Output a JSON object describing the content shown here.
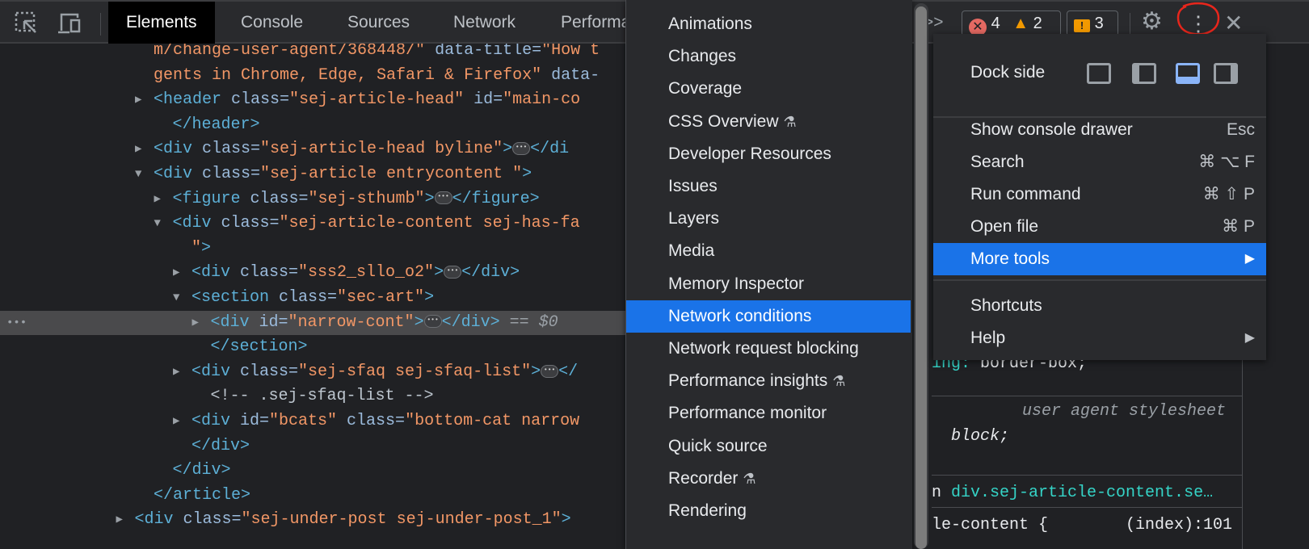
{
  "toolbar": {
    "tabs": [
      "Elements",
      "Console",
      "Sources",
      "Network",
      "Performance"
    ],
    "more_tabs_label": ">>",
    "errors": "4",
    "warnings": "2",
    "issues": "3"
  },
  "dom": [
    {
      "indent": 0,
      "arrow": "",
      "segs": [
        [
          "val",
          "m/change-user-agent/368448/\""
        ],
        [
          "attr",
          " data-title="
        ],
        [
          "val",
          "\"How t"
        ]
      ]
    },
    {
      "indent": 0,
      "arrow": "",
      "segs": [
        [
          "val",
          "gents in Chrome, Edge, Safari & Firefox\""
        ],
        [
          "attr",
          " data-"
        ]
      ]
    },
    {
      "indent": 0,
      "arrow": "right",
      "segs": [
        [
          "tag",
          "<header"
        ],
        [
          "attr",
          " class="
        ],
        [
          "val",
          "\"sej-article-head\""
        ],
        [
          "attr",
          " id="
        ],
        [
          "val",
          "\"main-co"
        ]
      ]
    },
    {
      "indent": 1,
      "arrow": "",
      "segs": [
        [
          "tag",
          "</header>"
        ]
      ]
    },
    {
      "indent": 0,
      "arrow": "right",
      "segs": [
        [
          "tag",
          "<div"
        ],
        [
          "attr",
          " class="
        ],
        [
          "val",
          "\"sej-article-head byline\""
        ],
        [
          "tag",
          ">"
        ],
        [
          "dots",
          ""
        ],
        [
          "tag",
          "</di"
        ]
      ]
    },
    {
      "indent": 0,
      "arrow": "down",
      "segs": [
        [
          "tag",
          "<div"
        ],
        [
          "attr",
          " class="
        ],
        [
          "val",
          "\"sej-article entrycontent \""
        ],
        [
          "tag",
          ">"
        ]
      ]
    },
    {
      "indent": 1,
      "arrow": "right",
      "segs": [
        [
          "tag",
          "<figure"
        ],
        [
          "attr",
          " class="
        ],
        [
          "val",
          "\"sej-sthumb\""
        ],
        [
          "tag",
          ">"
        ],
        [
          "dots",
          ""
        ],
        [
          "tag",
          "</figure>"
        ]
      ]
    },
    {
      "indent": 1,
      "arrow": "down",
      "segs": [
        [
          "tag",
          "<div"
        ],
        [
          "attr",
          " class="
        ],
        [
          "val",
          "\"sej-article-content sej-has-fa"
        ]
      ]
    },
    {
      "indent": 2,
      "arrow": "",
      "segs": [
        [
          "val",
          "\""
        ],
        [
          "tag",
          ">"
        ]
      ]
    },
    {
      "indent": 2,
      "arrow": "right",
      "segs": [
        [
          "tag",
          "<div"
        ],
        [
          "attr",
          " class="
        ],
        [
          "val",
          "\"sss2_sllo_o2\""
        ],
        [
          "tag",
          ">"
        ],
        [
          "dots",
          ""
        ],
        [
          "tag",
          "</div>"
        ]
      ]
    },
    {
      "indent": 2,
      "arrow": "down",
      "segs": [
        [
          "tag",
          "<section"
        ],
        [
          "attr",
          " class="
        ],
        [
          "val",
          "\"sec-art\""
        ],
        [
          "tag",
          ">"
        ]
      ]
    },
    {
      "indent": 3,
      "arrow": "right",
      "selected": true,
      "segs": [
        [
          "tag",
          "<div"
        ],
        [
          "attr",
          " id="
        ],
        [
          "val",
          "\"narrow-cont\""
        ],
        [
          "tag",
          ">"
        ],
        [
          "dots",
          ""
        ],
        [
          "tag",
          "</div>"
        ],
        [
          "eq",
          " == $0"
        ]
      ]
    },
    {
      "indent": 3,
      "arrow": "",
      "segs": [
        [
          "tag",
          "</section>"
        ]
      ]
    },
    {
      "indent": 2,
      "arrow": "right",
      "segs": [
        [
          "tag",
          "<div"
        ],
        [
          "attr",
          " class="
        ],
        [
          "val",
          "\"sej-sfaq sej-sfaq-list\""
        ],
        [
          "tag",
          ">"
        ],
        [
          "dots",
          ""
        ],
        [
          "tag",
          "</"
        ]
      ]
    },
    {
      "indent": 3,
      "arrow": "",
      "segs": [
        [
          "comment",
          "<!-- .sej-sfaq-list -->"
        ]
      ]
    },
    {
      "indent": 2,
      "arrow": "right",
      "segs": [
        [
          "tag",
          "<div"
        ],
        [
          "attr",
          " id="
        ],
        [
          "val",
          "\"bcats\""
        ],
        [
          "attr",
          " class="
        ],
        [
          "val",
          "\"bottom-cat narrow"
        ]
      ]
    },
    {
      "indent": 2,
      "arrow": "",
      "segs": [
        [
          "tag",
          "</div>"
        ]
      ]
    },
    {
      "indent": 1,
      "arrow": "",
      "segs": [
        [
          "tag",
          "</div>"
        ]
      ]
    },
    {
      "indent": 0,
      "arrow": "",
      "segs": [
        [
          "tag",
          "</article>"
        ]
      ]
    },
    {
      "indent": -1,
      "arrow": "right",
      "segs": [
        [
          "tag",
          "<div"
        ],
        [
          "attr",
          " class="
        ],
        [
          "val",
          "\"sej-under-post sej-under-post_1\""
        ],
        [
          "tag",
          ">"
        ]
      ]
    }
  ],
  "more_tools_menu": {
    "items": [
      {
        "label": "Animations"
      },
      {
        "label": "Changes"
      },
      {
        "label": "Coverage"
      },
      {
        "label": "CSS Overview",
        "experimental": true
      },
      {
        "label": "Developer Resources"
      },
      {
        "label": "Issues"
      },
      {
        "label": "Layers"
      },
      {
        "label": "Media"
      },
      {
        "label": "Memory Inspector"
      },
      {
        "label": "Network conditions",
        "highlighted": true
      },
      {
        "label": "Network request blocking"
      },
      {
        "label": "Performance insights",
        "experimental": true
      },
      {
        "label": "Performance monitor"
      },
      {
        "label": "Quick source"
      },
      {
        "label": "Recorder",
        "experimental": true
      },
      {
        "label": "Rendering"
      }
    ]
  },
  "main_menu": {
    "dock_side_label": "Dock side",
    "dock_options": [
      "undock",
      "left",
      "bottom",
      "right"
    ],
    "dock_selected": "bottom",
    "items": [
      {
        "label": "Show console drawer",
        "shortcut": "Esc"
      },
      {
        "label": "Search",
        "shortcut": "⌘ ⌥ F"
      },
      {
        "label": "Run command",
        "shortcut": "⌘ ⇧ P"
      },
      {
        "label": "Open file",
        "shortcut": "⌘ P"
      },
      {
        "label": "More tools",
        "shortcut": "▶",
        "highlighted": true
      },
      {
        "label": "Shortcuts",
        "shortcut": ""
      },
      {
        "label": "Help",
        "shortcut": "▶"
      }
    ]
  },
  "styles": {
    "line1_prop": "ing:",
    "line1_val": " border-box;",
    "ua_label": "user agent stylesheet",
    "line3": "  block;",
    "inherited_prefix": "n ",
    "inherited_selector": "div.sej-article-content.se…",
    "rule_selector": "le-content {",
    "rule_source": "(index):101"
  },
  "colors": {
    "accent": "#1a73e8",
    "annotation": "#e8261c",
    "tag": "#5db0d7",
    "attr": "#9bbbdc",
    "value": "#f29766"
  }
}
